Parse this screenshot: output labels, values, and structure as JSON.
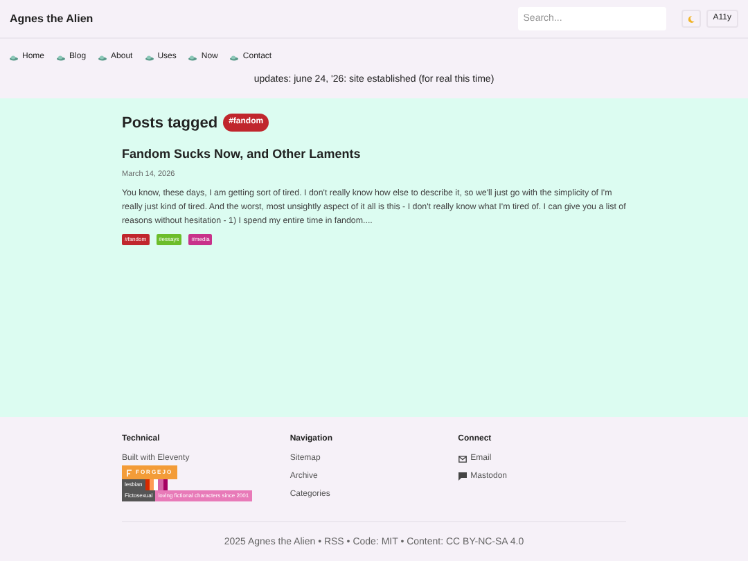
{
  "site_title": "Agnes the Alien",
  "search": {
    "placeholder": "Search..."
  },
  "header_buttons": [
    {
      "kind": "moon"
    },
    {
      "kind": "text",
      "label": "A11y"
    }
  ],
  "nav": [
    "Home",
    "Blog",
    "About",
    "Uses",
    "Now",
    "Contact"
  ],
  "updates": "updates: june 24, '26: site established (for real this time)",
  "heading": "Posts tagged",
  "heading_tag": "#fandom",
  "posts": [
    {
      "title": "Fandom Sucks Now, and Other Laments",
      "date": "March 14, 2026",
      "excerpt": "You know, these days, I am getting sort of tired. I don't really know how else to describe it, so we'll just go with the simplicity of I'm really just kind of tired. And the worst, most unsightly aspect of it all is this - I don't really know what I'm tired of. I can give you a list of reasons without hesitation - 1) I spend my entire time in fandom....",
      "tags": [
        {
          "label": "#fandom",
          "color": "#c0262d"
        },
        {
          "label": "#essays",
          "color": "#6cbd2a"
        },
        {
          "label": "#media",
          "color": "#c8318a"
        }
      ]
    }
  ],
  "footer": {
    "technical": {
      "title": "Technical",
      "text": "Built with Eleventy",
      "forgejo": "FORGEJO",
      "badges": [
        {
          "label": "lesbian",
          "kind": "flag"
        },
        {
          "label": "Fictosexual",
          "kind": "text",
          "value": "loving fictional characters since 2001"
        }
      ]
    },
    "navigation": {
      "title": "Navigation",
      "links": [
        "Sitemap",
        "Archive",
        "Categories"
      ]
    },
    "connect": {
      "title": "Connect",
      "links": [
        {
          "label": "Email",
          "kind": "mail"
        },
        {
          "label": "Mastodon",
          "kind": "chat"
        }
      ]
    },
    "copyright": "2025 Agnes the Alien • RSS • Code: MIT • Content: CC BY-NC-SA 4.0"
  }
}
